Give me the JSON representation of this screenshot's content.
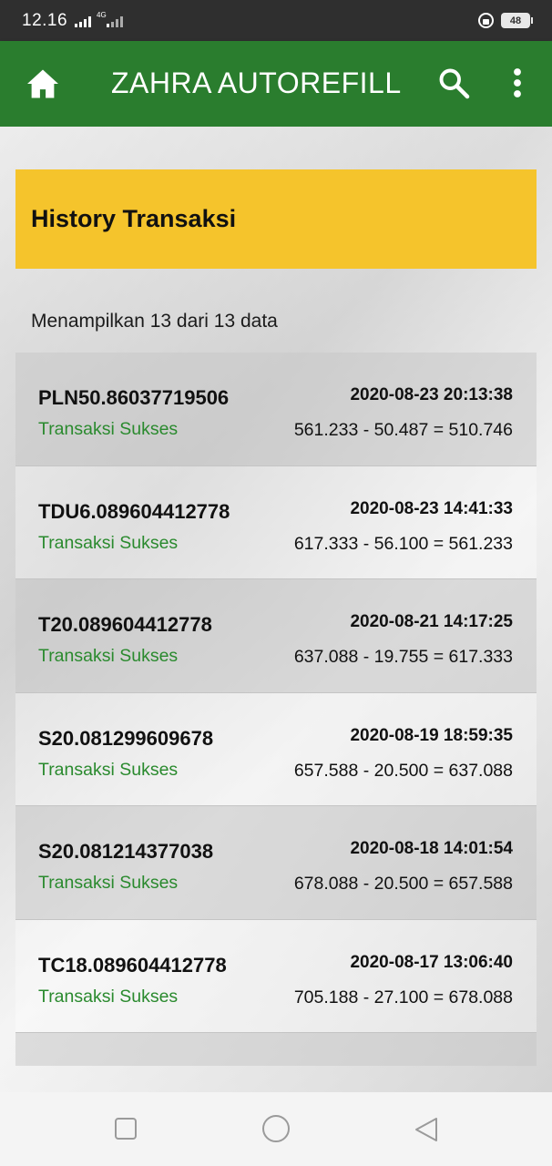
{
  "status_bar": {
    "time": "12.16",
    "network": "4G",
    "battery": "48"
  },
  "app_bar": {
    "title": "ZAHRA AUTOREFILL"
  },
  "header": {
    "title": "History Transaksi",
    "count_text": "Menampilkan 13 dari 13 data"
  },
  "transactions": [
    {
      "code": "PLN50.86037719506",
      "status": "Transaksi Sukses",
      "datetime": "2020-08-23 20:13:38",
      "balance": "561.233 - 50.487 = 510.746"
    },
    {
      "code": "TDU6.089604412778",
      "status": "Transaksi Sukses",
      "datetime": "2020-08-23 14:41:33",
      "balance": "617.333 - 56.100 = 561.233"
    },
    {
      "code": "T20.089604412778",
      "status": "Transaksi Sukses",
      "datetime": "2020-08-21 14:17:25",
      "balance": "637.088 - 19.755 = 617.333"
    },
    {
      "code": "S20.081299609678",
      "status": "Transaksi Sukses",
      "datetime": "2020-08-19 18:59:35",
      "balance": "657.588 - 20.500 = 637.088"
    },
    {
      "code": "S20.081214377038",
      "status": "Transaksi Sukses",
      "datetime": "2020-08-18 14:01:54",
      "balance": "678.088 - 20.500 = 657.588"
    },
    {
      "code": "TC18.089604412778",
      "status": "Transaksi Sukses",
      "datetime": "2020-08-17 13:06:40",
      "balance": "705.188 - 27.100 = 678.088"
    }
  ],
  "colors": {
    "app_bar": "#2a7d2e",
    "banner": "#f5c42c",
    "success_text": "#2a8a2e"
  },
  "icons": {
    "home": "home-icon",
    "search": "search-icon",
    "more": "more-vert-icon",
    "recents": "square-icon",
    "home_nav": "circle-icon",
    "back": "triangle-back-icon"
  }
}
